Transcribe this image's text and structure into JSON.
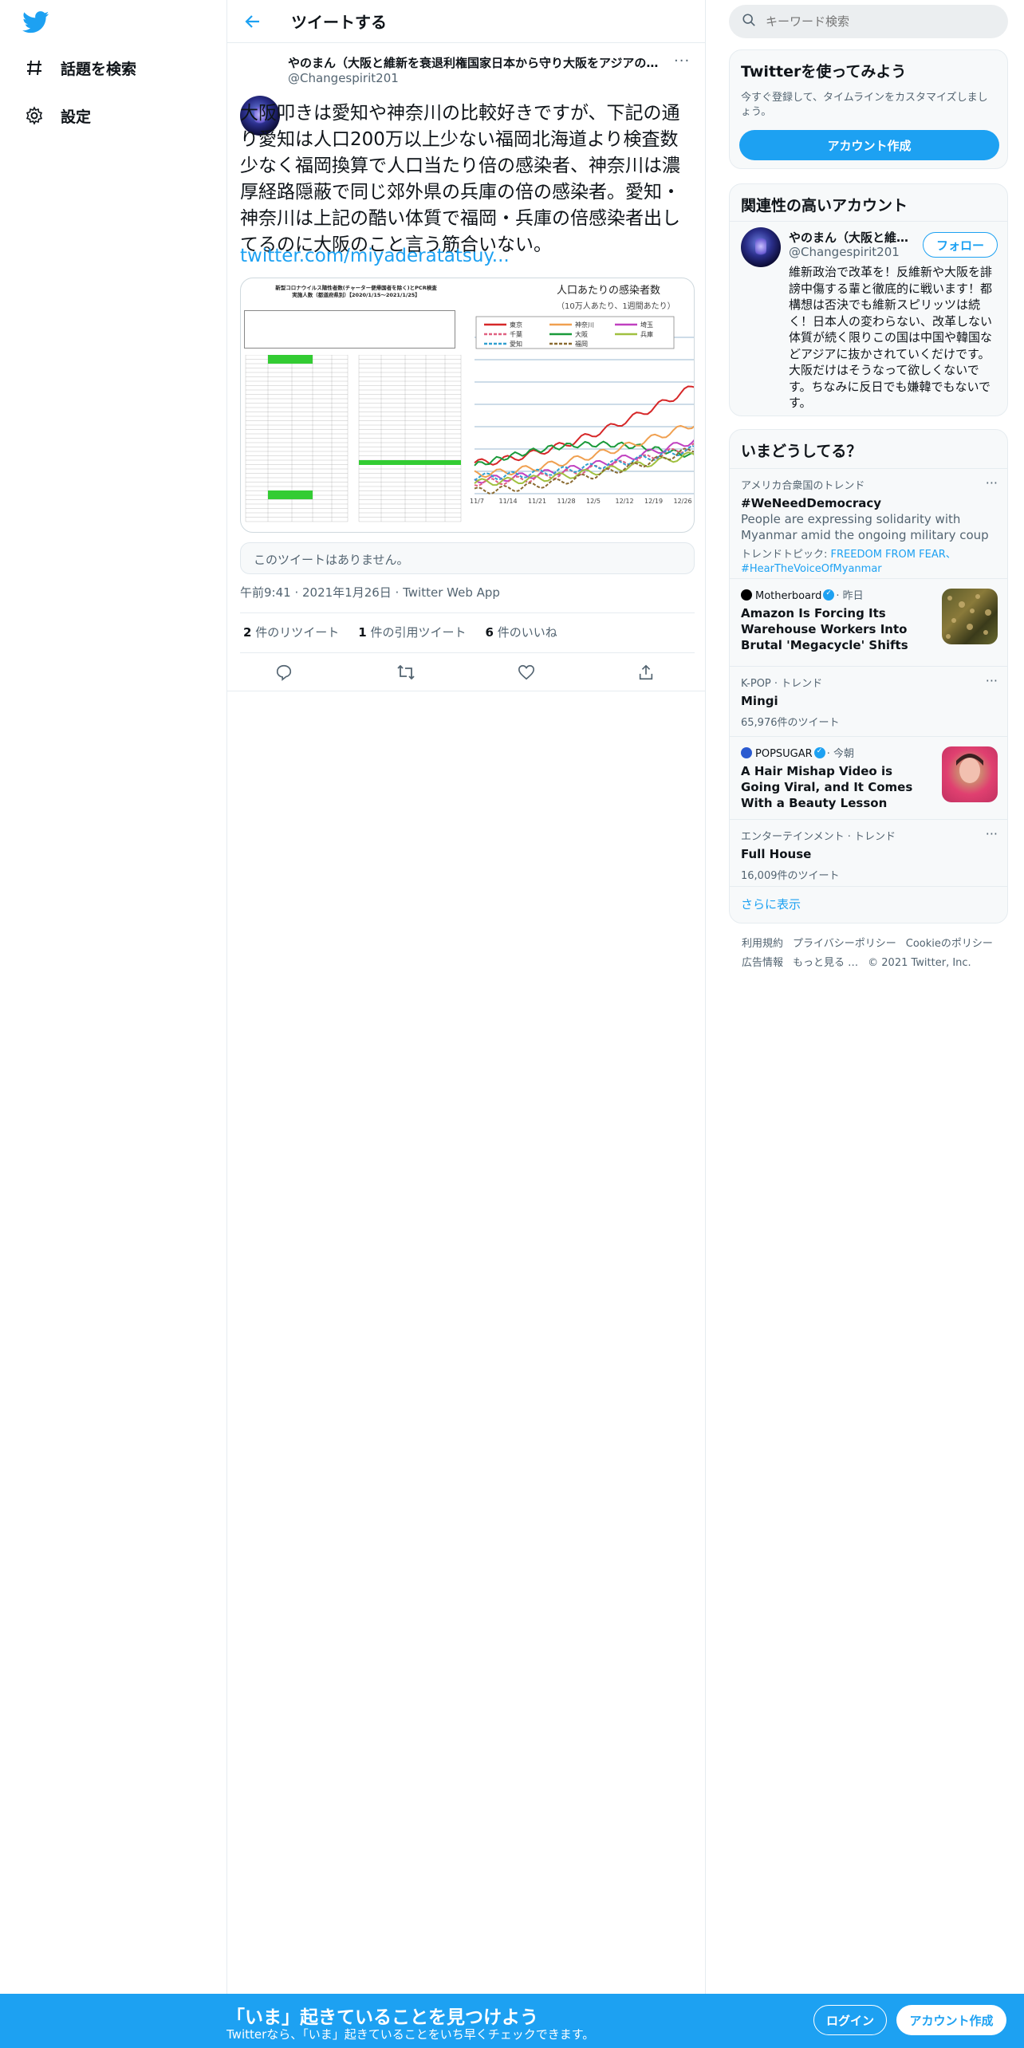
{
  "nav": {
    "items": [
      {
        "label": "話題を検索",
        "icon": "hashtag-icon"
      },
      {
        "label": "設定",
        "icon": "gear-icon"
      }
    ]
  },
  "header": {
    "title": "ツイートする"
  },
  "tweet": {
    "author_name": "やのまん（大阪と維新を衰退利権国家日本から守り大阪をアジアの…",
    "author_handle": "@Changespirit201",
    "text": "大阪叩きは愛知や神奈川の比較好きですが、下記の通り愛知は人口200万以上少ない福岡北海道より検査数少なく福岡換算で人口当たり倍の感染者、神奈川は濃厚経路隠蔽で同じ郊外県の兵庫の倍の感染者。愛知・神奈川は上記の酷い体質で福岡・兵庫の倍感染者出してるのに大阪のこと言う筋合いない。",
    "link": "twitter.com/miyaderatatsuy...",
    "quote_unavailable": "このツイートはありません。",
    "meta": "午前9:41 · 2021年1月26日 · Twitter Web App",
    "retweets_count": "2",
    "retweets_label": "件のリツイート",
    "quotes_count": "1",
    "quotes_label": "件の引用ツイート",
    "likes_count": "6",
    "likes_label": "件のいいね"
  },
  "media": {
    "left_title": "新型コロナウイルス陽性者数(チャーター便帰国者を除く)とPCR検査",
    "left_subtitle": "実施人数（都道府県別）【2020/1/15～2021/1/25】",
    "chart_title": "人口あたりの感染者数",
    "chart_subtitle": "（10万人あたり、1週間あたり）",
    "x_ticks": [
      "11/7",
      "11/14",
      "11/21",
      "11/28",
      "12/5",
      "12/12",
      "12/19",
      "12/26"
    ],
    "legend": [
      {
        "name": "東京",
        "color": "#d62728",
        "dash": "solid"
      },
      {
        "name": "神奈川",
        "color": "#f0a050",
        "dash": "solid"
      },
      {
        "name": "埼玉",
        "color": "#c040c0",
        "dash": "solid"
      },
      {
        "name": "千葉",
        "color": "#e06080",
        "dash": "dash"
      },
      {
        "name": "大阪",
        "color": "#1a9a3a",
        "dash": "solid"
      },
      {
        "name": "兵庫",
        "color": "#a0c040",
        "dash": "solid"
      },
      {
        "name": "愛知",
        "color": "#30a0d0",
        "dash": "dash"
      },
      {
        "name": "福岡",
        "color": "#8a6a30",
        "dash": "dash"
      }
    ]
  },
  "search": {
    "placeholder": "キーワード検索"
  },
  "signup_card": {
    "title": "Twitterを使ってみよう",
    "subtitle": "今すぐ登録して、タイムラインをカスタマイズしましょう。",
    "button": "アカウント作成"
  },
  "related": {
    "title": "関連性の高いアカウント",
    "name": "やのまん（大阪と維…",
    "handle": "@Changespirit201",
    "follow": "フォロー",
    "bio": "維新政治で改革を！反維新や大阪を誹謗中傷する輩と徹底的に戦います！都構想は否決でも維新スピリッツは続く！日本人の変わらない、改革しない体質が続く限りこの国は中国や韓国などアジアに抜かされていくだけです。大阪だけはそうなって欲しくないです。ちなみに反日でも嫌韓でもないです。"
  },
  "trends": {
    "title": "いまどうしてる？",
    "items": [
      {
        "context": "アメリカ合衆国のトレンド",
        "name": "#WeNeedDemocracy",
        "desc": "People are expressing solidarity with Myanmar amid the ongoing military coup",
        "topics_label": "トレンドトピック: ",
        "topics": "FREEDOM FROM FEAR、#HearTheVoiceOfMyanmar"
      },
      {
        "source": "Motherboard",
        "time": "· 昨日",
        "name": "Amazon Is Forcing Its Warehouse Workers Into Brutal 'Megacycle' Shifts"
      },
      {
        "context": "K-POP · トレンド",
        "name": "Mingi",
        "count": "65,976件のツイート"
      },
      {
        "source": "POPSUGAR",
        "time": "· 今朝",
        "name": "A Hair Mishap Video is Going Viral, and It Comes With a Beauty Lesson"
      },
      {
        "context": "エンターテインメント · トレンド",
        "name": "Full House",
        "count": "16,009件のツイート"
      }
    ],
    "show_more": "さらに表示"
  },
  "footer": {
    "links": [
      "利用規約",
      "プライバシーポリシー",
      "Cookieのポリシー",
      "広告情報",
      "もっと見る …",
      "© 2021 Twitter, Inc."
    ]
  },
  "bottom_bar": {
    "title": "「いま」起きていることを見つけよう",
    "subtitle": "Twitterなら、「いま」起きていることをいち早くチェックできます。",
    "login": "ログイン",
    "signup": "アカウント作成"
  },
  "colors": {
    "accent": "#1da1f2",
    "text": "#0f1419",
    "muted": "#536471"
  }
}
